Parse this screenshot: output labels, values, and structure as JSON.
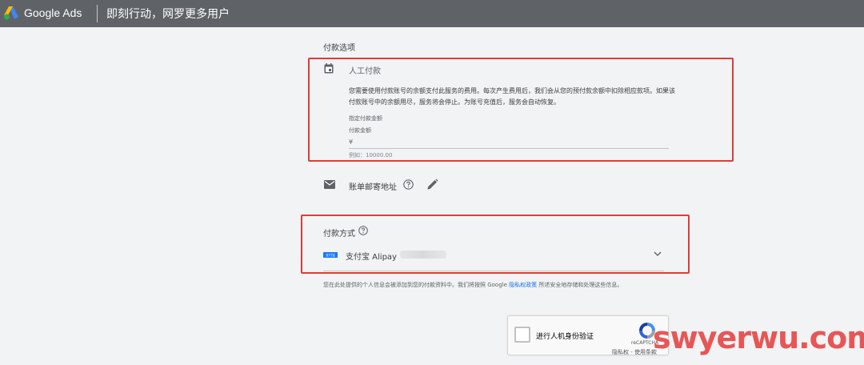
{
  "topbar": {
    "brand": "Google Ads",
    "slogan": "即刻行动，网罗更多用户",
    "bg_color": "#5f6368"
  },
  "payment_options": {
    "section_title": "付款选项",
    "manual": {
      "icon": "calendar-icon",
      "title": "人工付款",
      "description": "您需要使用付款账号的余额支付此服务的费用。每次产生费用后，我们会从您的预付款余额中扣除相应款项。如果该付款账号中的余额用尽，服务将会停止。为账号充值后，服务会自动恢复。",
      "field_label_1": "指定付款金额",
      "field_label_2": "付款金额",
      "currency_symbol": "¥",
      "amount_placeholder": "例如：10000.00",
      "amount_value": ""
    }
  },
  "billing_address": {
    "icon": "mail-icon",
    "label": "账单邮寄地址",
    "help_icon": "help-icon",
    "edit_icon": "pencil-icon"
  },
  "payment_method": {
    "label": "付款方式",
    "help_icon": "help-icon",
    "logo_text": "支付宝",
    "selected": "支付宝 Alipay",
    "dropdown_icon": "chevron-down-icon"
  },
  "privacy": {
    "prefix": "您在此处提供的个人信息会被添加到您的付款资料中。我们将按照 Google ",
    "link": "隐私权政策",
    "suffix": " 所述安全地存储和处理这些信息。"
  },
  "recaptcha": {
    "label": "进行人机身份验证",
    "brand": "reCAPTCHA",
    "terms": "隐私权 - 使用条款"
  },
  "watermark": "swyerwu.com",
  "colors": {
    "highlight_red": "#e53935",
    "link_blue": "#1a73e8",
    "page_bg": "#f1f3f4"
  }
}
